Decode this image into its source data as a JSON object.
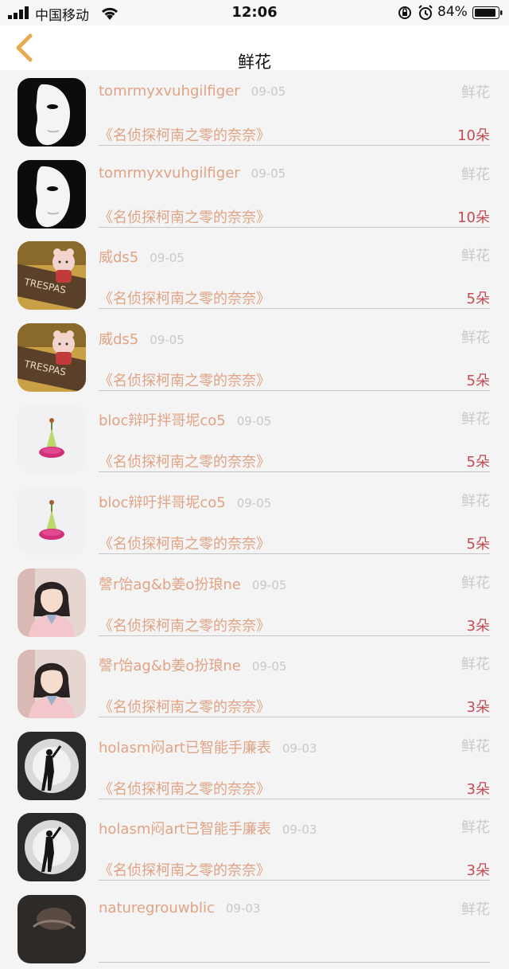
{
  "status_bar": {
    "carrier": "中国移动",
    "time": "12:06",
    "battery_pct": "84%"
  },
  "nav": {
    "title": "鲜花",
    "back_icon": "chevron-left-icon",
    "accent_color": "#e7ac52"
  },
  "rows": [
    {
      "username": "tomrmyxvuhgilfiger",
      "date": "09-05",
      "gift": "鲜花",
      "movie": "《名侦探柯南之零的奈奈》",
      "count": "10朵",
      "avatar": "mask"
    },
    {
      "username": "tomrmyxvuhgilfiger",
      "date": "09-05",
      "gift": "鲜花",
      "movie": "《名侦探柯南之零的奈奈》",
      "count": "10朵",
      "avatar": "mask"
    },
    {
      "username": "威ds5",
      "date": "09-05",
      "gift": "鲜花",
      "movie": "《名侦探柯南之零的奈奈》",
      "count": "5朵",
      "avatar": "toy"
    },
    {
      "username": "威ds5",
      "date": "09-05",
      "gift": "鲜花",
      "movie": "《名侦探柯南之零的奈奈》",
      "count": "5朵",
      "avatar": "toy"
    },
    {
      "username": "bloc辩吁拌哥坭co5",
      "date": "09-05",
      "gift": "鲜花",
      "movie": "《名侦探柯南之零的奈奈》",
      "count": "5朵",
      "avatar": "flower"
    },
    {
      "username": "bloc辩吁拌哥坭co5",
      "date": "09-05",
      "gift": "鲜花",
      "movie": "《名侦探柯南之零的奈奈》",
      "count": "5朵",
      "avatar": "flower"
    },
    {
      "username": "謦r饴ag&b姜o扮琅ne",
      "date": "09-05",
      "gift": "鲜花",
      "movie": "《名侦探柯南之零的奈奈》",
      "count": "3朵",
      "avatar": "girl"
    },
    {
      "username": "謦r饴ag&b姜o扮琅ne",
      "date": "09-05",
      "gift": "鲜花",
      "movie": "《名侦探柯南之零的奈奈》",
      "count": "3朵",
      "avatar": "girl"
    },
    {
      "username": "holasm闷art已智能手廉表",
      "date": "09-03",
      "gift": "鲜花",
      "movie": "《名侦探柯南之零的奈奈》",
      "count": "3朵",
      "avatar": "silhouette"
    },
    {
      "username": "holasm闷art已智能手廉表",
      "date": "09-03",
      "gift": "鲜花",
      "movie": "《名侦探柯南之零的奈奈》",
      "count": "3朵",
      "avatar": "silhouette"
    },
    {
      "username": "naturegrouwblic",
      "date": "09-03",
      "gift": "鲜花",
      "movie": "",
      "count": "",
      "avatar": "dark"
    }
  ]
}
